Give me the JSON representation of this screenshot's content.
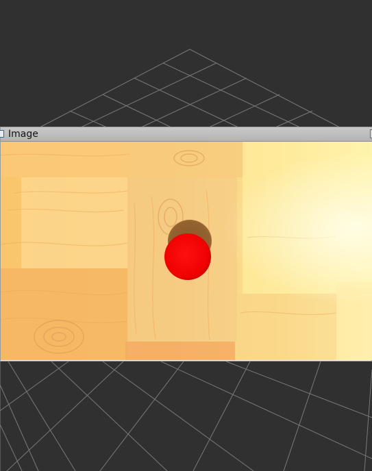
{
  "window": {
    "image_panel_title": "Image"
  },
  "icons": {
    "panel_icon": "image-panel-icon",
    "corner_button": "maximize-corner-icon"
  },
  "colors": {
    "viewport_background": "#303030",
    "grid_lines": "#7a7a7a",
    "panel_titlebar": "#b9b9b9",
    "wood_light": "#fff3a8",
    "wood_dark": "#f4ad54",
    "ball": "#ff0000",
    "ball_shadow": "#8a5a2d"
  }
}
